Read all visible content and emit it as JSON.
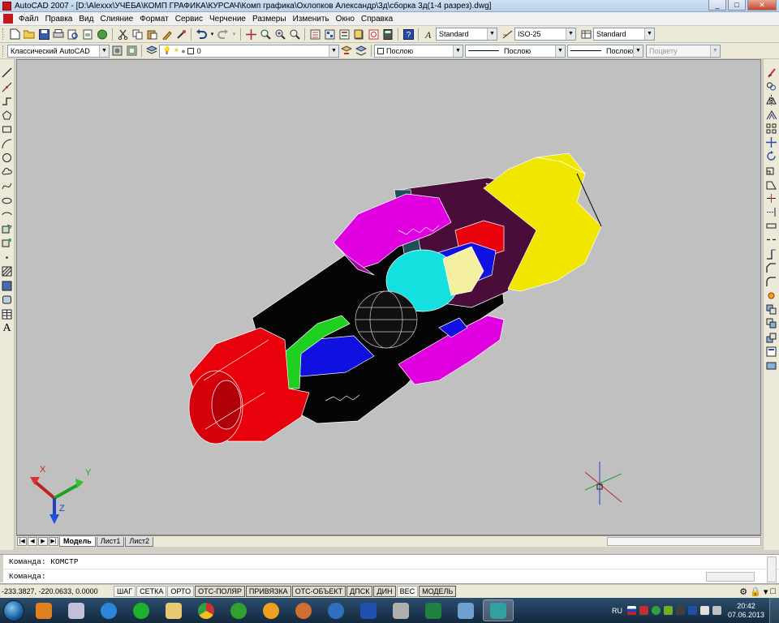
{
  "window": {
    "title": "AutoCAD 2007 - [D:\\Alexxx\\УЧЁБА\\КОМП ГРАФИКА\\КУРСАЧ\\Комп графика\\Охлопков Александр\\3д\\сборка 3д(1-4 разрез).dwg]",
    "minimize": "_",
    "maximize": "□",
    "close": "✕"
  },
  "menu": {
    "items": [
      "Файл",
      "Правка",
      "Вид",
      "Слияние",
      "Формат",
      "Сервис",
      "Черчение",
      "Размеры",
      "Изменить",
      "Окно",
      "Справка"
    ]
  },
  "toolbar1": {
    "text_style": "Standard",
    "dim_style": "ISO-25",
    "table_style": "Standard"
  },
  "toolbar2": {
    "workspace": "Классический AutoCAD",
    "layer": "0",
    "color": "Послою",
    "linetype": "Послою",
    "lineweight": "Послою",
    "plotstyle": "Поцвету"
  },
  "ucs": {
    "x": "X",
    "y": "Y",
    "z": "Z"
  },
  "tabs": {
    "model": "Модель",
    "sheet1": "Лист1",
    "sheet2": "Лист2"
  },
  "command": {
    "history": "Команда: КОМСТР",
    "prompt": "Команда:"
  },
  "status": {
    "coords": "-233.3827, -220.0633, 0.0000",
    "buttons": [
      "ШАГ",
      "СЕТКА",
      "ОРТО",
      "ОТС-ПОЛЯР",
      "ПРИВЯЗКА",
      "ОТС-ОБЪЕКТ",
      "ДПСК",
      "ДИН",
      "ВЕС",
      "МОДЕЛЬ"
    ]
  },
  "taskbar": {
    "lang": "RU",
    "time": "20:42",
    "date": "07.06.2013"
  },
  "colors": {
    "viewport_bg": "#c0c0c0",
    "part_red": "#e8000a",
    "part_magenta": "#e000e0",
    "part_yellow": "#f0e600",
    "part_cyan": "#14e0e0",
    "part_blue": "#1010e0",
    "part_green": "#20d020",
    "part_black": "#050505"
  }
}
